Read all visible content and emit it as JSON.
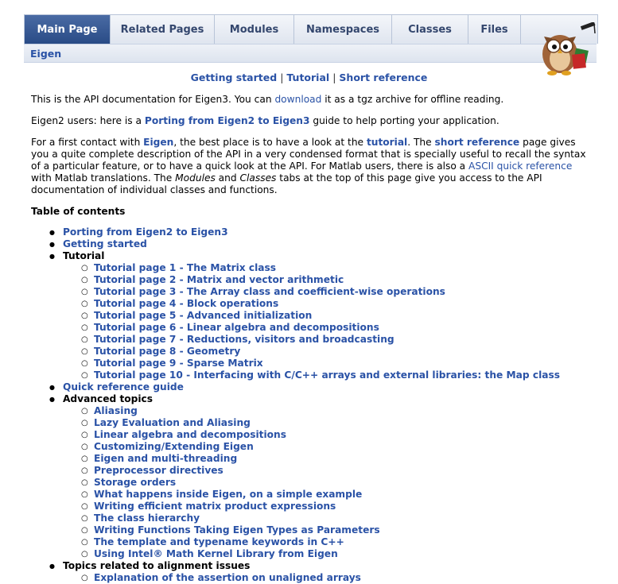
{
  "tabs": [
    "Main Page",
    "Related Pages",
    "Modules",
    "Namespaces",
    "Classes",
    "Files"
  ],
  "nav_path": "Eigen",
  "quick_links": {
    "getting_started": "Getting started",
    "sep": "|",
    "tutorial": "Tutorial",
    "short_reference": "Short reference"
  },
  "intro": {
    "p1_a": "This is the API documentation for Eigen3. You can ",
    "p1_link": "download",
    "p1_b": " it as a tgz archive for offline reading.",
    "p2_a": "Eigen2 users: here is a ",
    "p2_link": "Porting from Eigen2 to Eigen3",
    "p2_b": " guide to help porting your application.",
    "p3_a": "For a first contact with ",
    "p3_link1": "Eigen",
    "p3_b": ", the best place is to have a look at the ",
    "p3_link2": "tutorial",
    "p3_c": ". The ",
    "p3_link3": "short reference",
    "p3_d": " page gives you a quite complete description of the API in a very condensed format that is specially useful to recall the syntax of a particular feature, or to have a quick look at the API. For Matlab users, there is also a ",
    "p3_link4": "ASCII quick reference",
    "p3_e": " with Matlab translations. The ",
    "p3_em1": "Modules",
    "p3_f": " and ",
    "p3_em2": "Classes",
    "p3_g": " tabs at the top of this page give you access to the API documentation of individual classes and functions."
  },
  "toc": {
    "heading": "Table of contents",
    "porting": "Porting from Eigen2 to Eigen3",
    "getting_started": "Getting started",
    "tutorial": "Tutorial",
    "tutorial_pages": [
      "Tutorial page 1 - The Matrix class",
      "Tutorial page 2 - Matrix and vector arithmetic",
      "Tutorial page 3 - The Array class and coefficient-wise operations",
      "Tutorial page 4 - Block operations",
      "Tutorial page 5 - Advanced initialization",
      "Tutorial page 6 - Linear algebra and decompositions",
      "Tutorial page 7 - Reductions, visitors and broadcasting",
      "Tutorial page 8 - Geometry",
      "Tutorial page 9 - Sparse Matrix",
      "Tutorial page 10 - Interfacing with C/C++ arrays and external libraries: the Map class"
    ],
    "quick_ref": "Quick reference guide",
    "advanced": "Advanced topics",
    "advanced_items": [
      "Aliasing",
      "Lazy Evaluation and Aliasing",
      "Linear algebra and decompositions",
      "Customizing/Extending Eigen",
      "Eigen and multi-threading",
      "Preprocessor directives",
      "Storage orders",
      "What happens inside Eigen, on a simple example",
      "Writing efficient matrix product expressions",
      "The class hierarchy",
      "Writing Functions Taking Eigen Types as Parameters",
      "The template and typename keywords in C++",
      "Using Intel® Math Kernel Library from Eigen"
    ],
    "alignment": "Topics related to alignment issues",
    "alignment_items": [
      "Explanation of the assertion on unaligned arrays"
    ]
  }
}
